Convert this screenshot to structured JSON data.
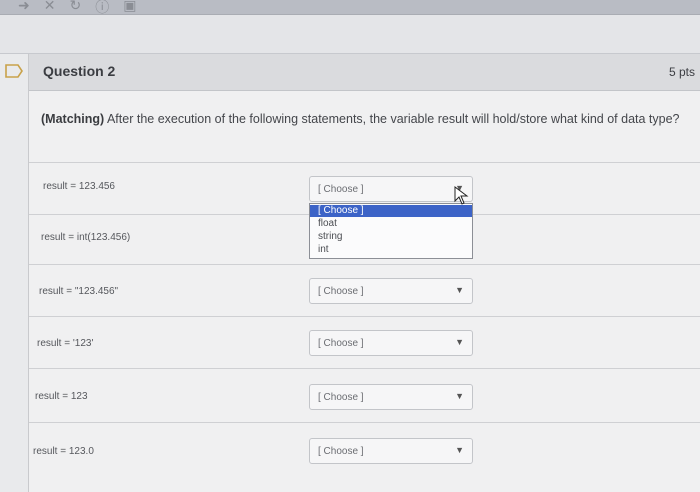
{
  "question": {
    "title": "Question 2",
    "points": "5 pts",
    "prompt_prefix": "(Matching)",
    "prompt_text": " After the execution of the following statements, the variable result will hold/store what kind of data type?"
  },
  "rows": [
    {
      "label": "result = 123.456",
      "selected": "[ Choose ]"
    },
    {
      "label": "result = int(123.456)",
      "selected": ""
    },
    {
      "label": "result = \"123.456\"",
      "selected": "[ Choose ]"
    },
    {
      "label": "result = '123'",
      "selected": "[ Choose ]"
    },
    {
      "label": "result = 123",
      "selected": "[ Choose ]"
    },
    {
      "label": "result = 123.0",
      "selected": "[ Choose ]"
    }
  ],
  "dropdown": {
    "options": [
      "[ Choose ]",
      "float",
      "string",
      "int"
    ],
    "highlighted": "[ Choose ]"
  },
  "icons": [
    "chevron-down-icon",
    "flag-icon",
    "mouse-cursor-icon"
  ]
}
